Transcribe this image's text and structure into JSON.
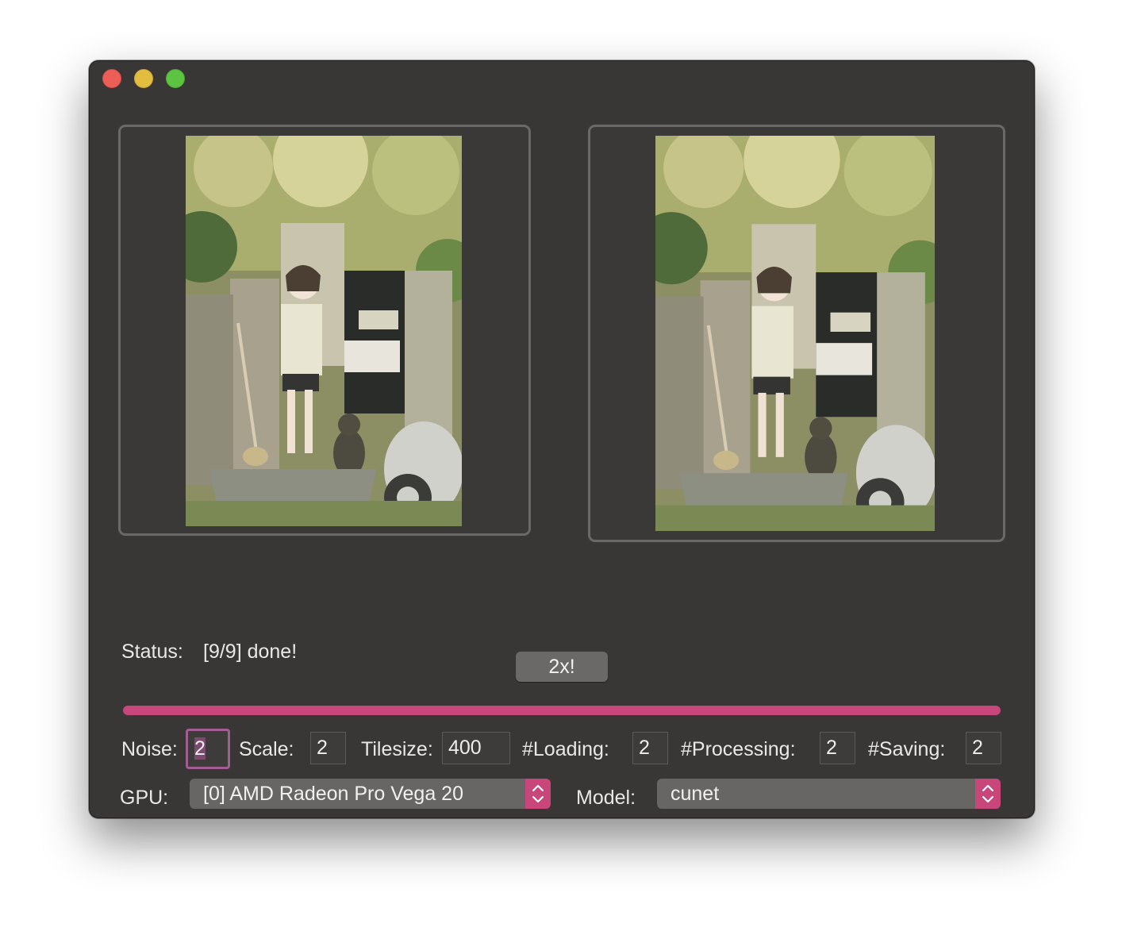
{
  "window": {
    "controls": [
      "close",
      "minimize",
      "zoom"
    ]
  },
  "images": {
    "left": {
      "icon": "input-image-preview"
    },
    "right": {
      "icon": "output-image-preview"
    }
  },
  "status": {
    "label": "Status:",
    "value": "[9/9] done!"
  },
  "run_button": {
    "label": "2x!"
  },
  "progress": {
    "fraction": 1.0,
    "color": "#c9467a"
  },
  "settings": {
    "noise": {
      "label": "Noise:",
      "value": "2"
    },
    "scale": {
      "label": "Scale:",
      "value": "2"
    },
    "tilesize": {
      "label": "Tilesize:",
      "value": "400"
    },
    "loading": {
      "label": "#Loading:",
      "value": "2"
    },
    "processing": {
      "label": "#Processing:",
      "value": "2"
    },
    "saving": {
      "label": "#Saving:",
      "value": "2"
    }
  },
  "gpu": {
    "label": "GPU:",
    "selected": "[0] AMD Radeon Pro Vega 20"
  },
  "model": {
    "label": "Model:",
    "selected": "cunet"
  },
  "colors": {
    "window_bg": "#383736",
    "accent": "#c9467a",
    "focus_ring": "#a25e93"
  }
}
